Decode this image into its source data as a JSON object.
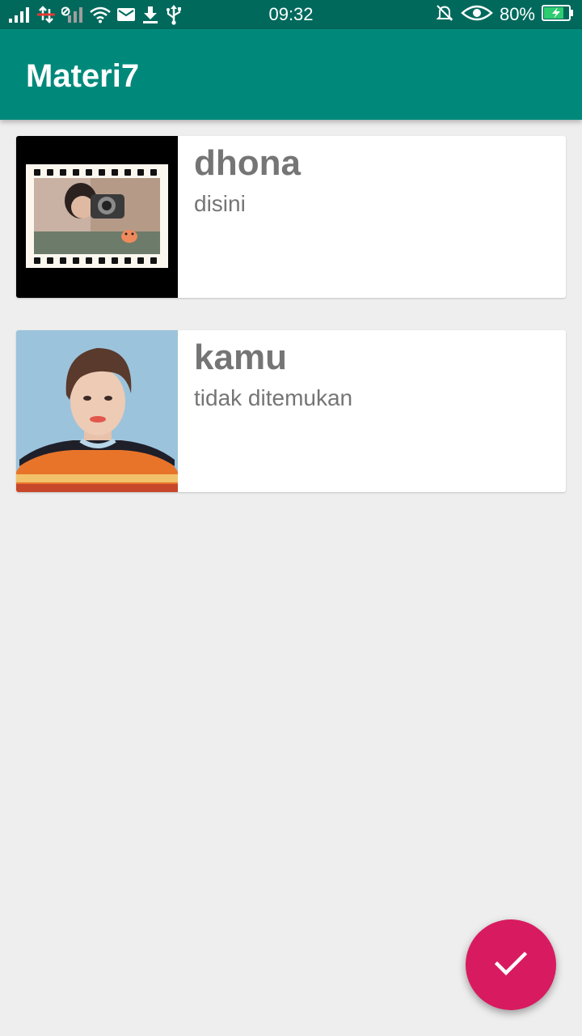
{
  "status_bar": {
    "time": "09:32",
    "battery_percent": "80%",
    "battery_level": 0.8,
    "icons_left": [
      "signal-icon",
      "data-off-icon",
      "signal-off-icon",
      "wifi-icon",
      "mail-icon",
      "download-icon",
      "usb-icon"
    ],
    "icons_right": [
      "bell-off-icon",
      "eye-icon",
      "battery-charging-icon"
    ]
  },
  "app_bar": {
    "title": "Materi7",
    "color": "#00897b"
  },
  "items": [
    {
      "title": "dhona",
      "subtitle": "disini",
      "image": "film-strip-selfie-photo"
    },
    {
      "title": "kamu",
      "subtitle": "tidak ditemukan",
      "image": "portrait-photo"
    }
  ],
  "fab": {
    "icon": "check-icon",
    "color": "#d81b60"
  }
}
